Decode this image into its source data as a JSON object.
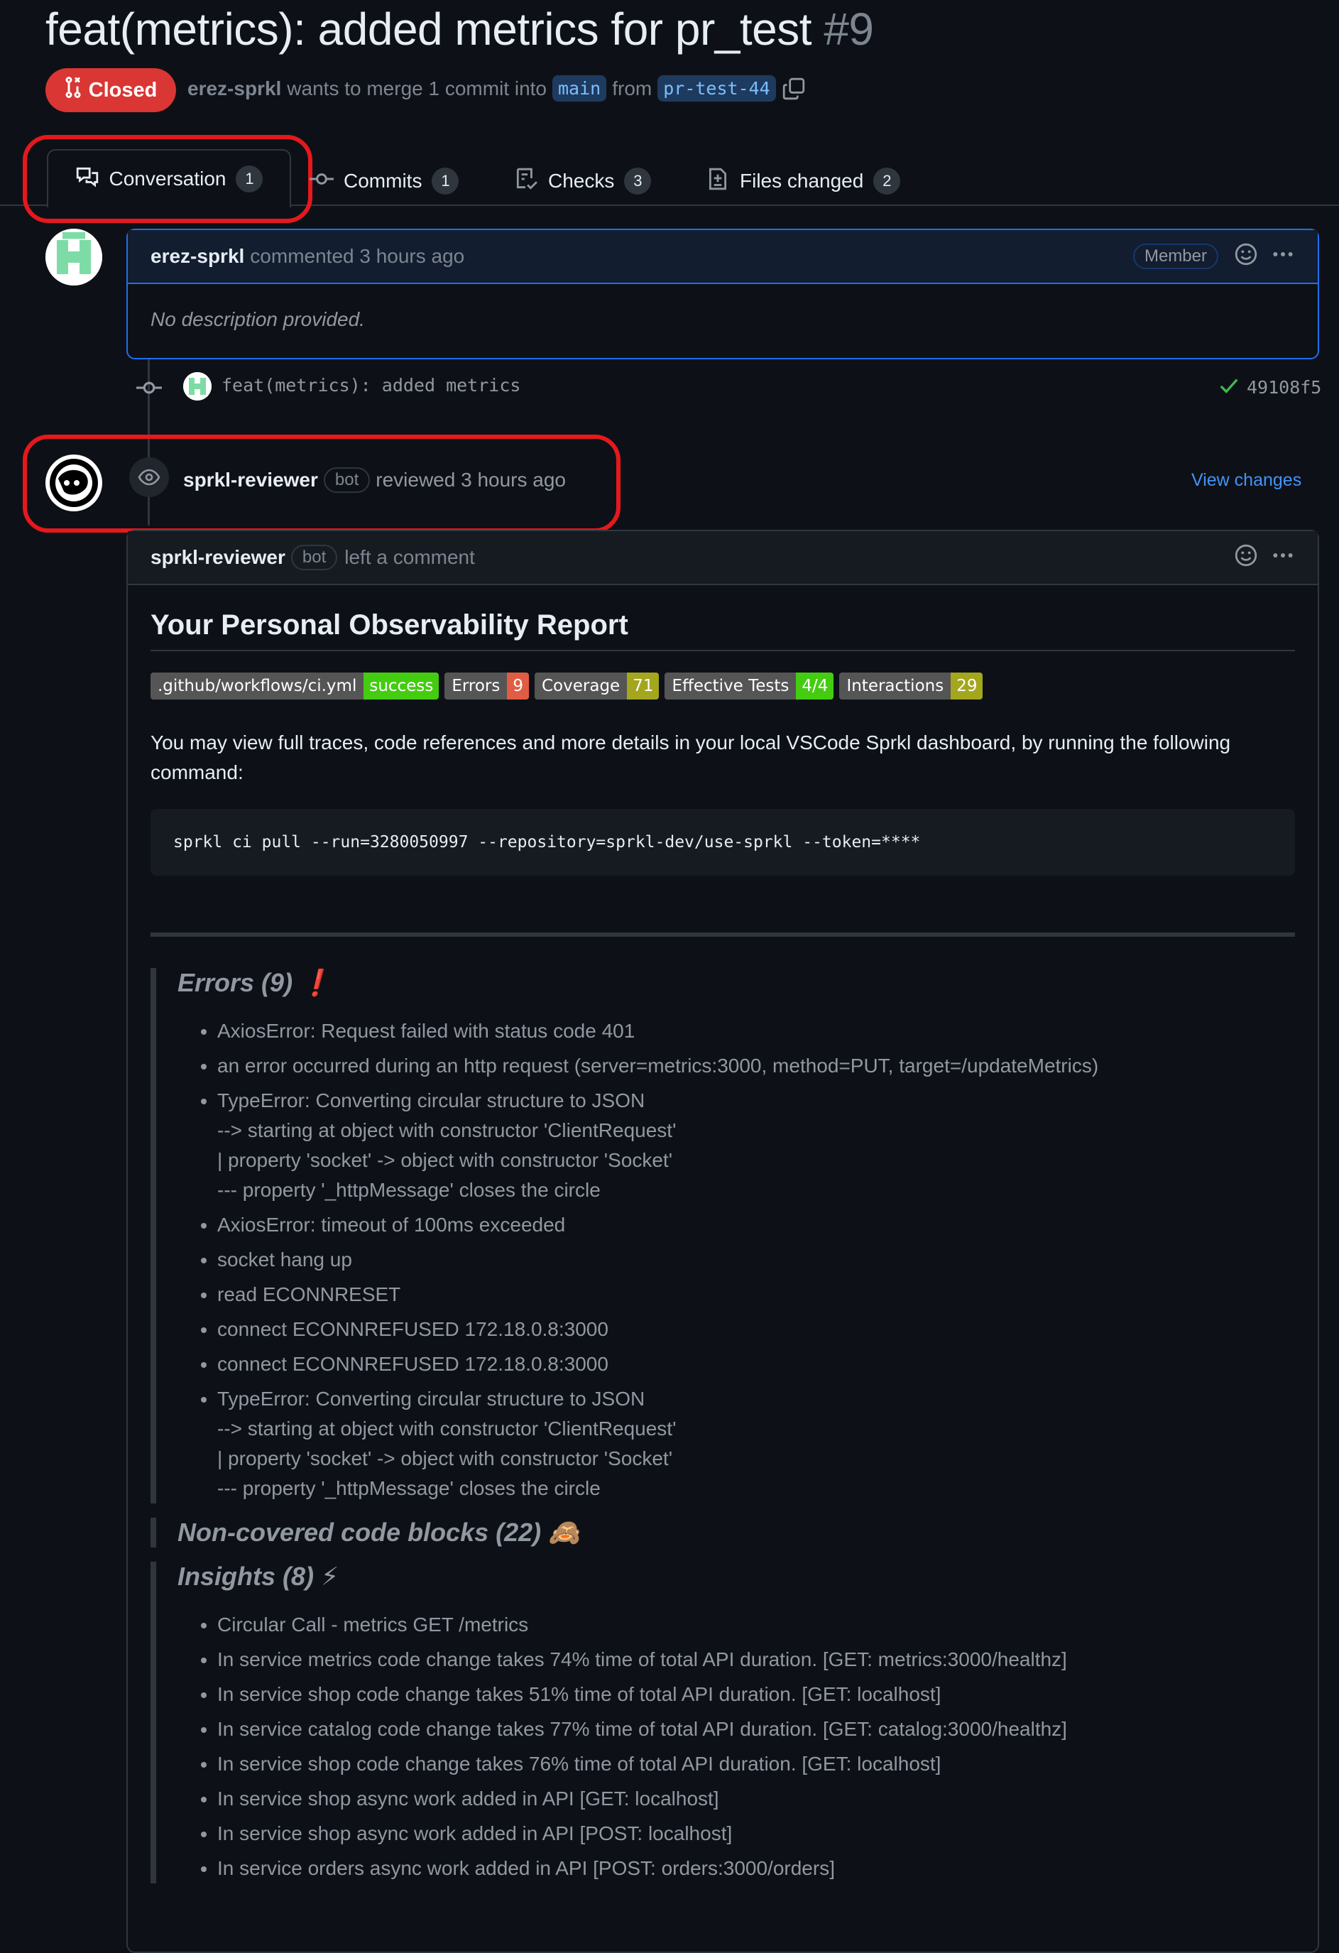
{
  "pr": {
    "title": "feat(metrics): added metrics for pr_test",
    "number": "#9",
    "state": "Closed",
    "author": "erez-sprkl",
    "merge_text": "wants to merge 1 commit into",
    "base_branch": "main",
    "from_text": "from",
    "head_branch": "pr-test-44"
  },
  "tabs": [
    {
      "label": "Conversation",
      "count": "1"
    },
    {
      "label": "Commits",
      "count": "1"
    },
    {
      "label": "Checks",
      "count": "3"
    },
    {
      "label": "Files changed",
      "count": "2"
    }
  ],
  "first_comment": {
    "author": "erez-sprkl",
    "action": "commented 3 hours ago",
    "role": "Member",
    "body": "No description provided."
  },
  "commit": {
    "message": "feat(metrics): added metrics",
    "sha": "49108f5"
  },
  "review_event": {
    "author": "sprkl-reviewer",
    "badge": "bot",
    "action": "reviewed 3 hours ago",
    "view_changes": "View changes"
  },
  "review_comment": {
    "author": "sprkl-reviewer",
    "badge": "bot",
    "action": "left a comment"
  },
  "report": {
    "heading": "Your Personal Observability Report",
    "badges": [
      {
        "label": ".github/workflows/ci.yml",
        "value": "success",
        "color": "#4c1"
      },
      {
        "label": "Errors",
        "value": "9",
        "color": "#e05d44"
      },
      {
        "label": "Coverage",
        "value": "71",
        "color": "#a4a61d"
      },
      {
        "label": "Effective Tests",
        "value": "4/4",
        "color": "#4c1"
      },
      {
        "label": "Interactions",
        "value": "29",
        "color": "#a4a61d"
      }
    ],
    "intro": "You may view full traces, code references and more details in your local VSCode Sprkl dashboard, by running the following command:",
    "command": "sprkl ci pull --run=3280050997 --repository=sprkl-dev/use-sprkl --token=****",
    "errors_title": "Errors (9) ❗",
    "errors": [
      "AxiosError: Request failed with status code 401",
      "an error occurred during an http request (server=metrics:3000, method=PUT, target=/updateMetrics)",
      "TypeError: Converting circular structure to JSON\n--> starting at object with constructor 'ClientRequest'\n| property 'socket' -> object with constructor 'Socket'\n--- property '_httpMessage' closes the circle",
      "AxiosError: timeout of 100ms exceeded",
      "socket hang up",
      "read ECONNRESET",
      "connect ECONNREFUSED 172.18.0.8:3000",
      "connect ECONNREFUSED 172.18.0.8:3000",
      "TypeError: Converting circular structure to JSON\n--> starting at object with constructor 'ClientRequest'\n| property 'socket' -> object with constructor 'Socket'\n--- property '_httpMessage' closes the circle"
    ],
    "noncovered_title": "Non-covered code blocks (22) 🙈",
    "insights_title": "Insights (8) ⚡",
    "insights": [
      "Circular Call - metrics GET /metrics",
      "In service metrics code change takes 74% time of total API duration. [GET: metrics:3000/healthz]",
      "In service shop code change takes 51% time of total API duration. [GET: localhost]",
      "In service catalog code change takes 77% time of total API duration. [GET: catalog:3000/healthz]",
      "In service shop code change takes 76% time of total API duration. [GET: localhost]",
      "In service shop async work added in API [GET: localhost]",
      "In service shop async work added in API [POST: localhost]",
      "In service orders async work added in API [POST: orders:3000/orders]"
    ]
  }
}
